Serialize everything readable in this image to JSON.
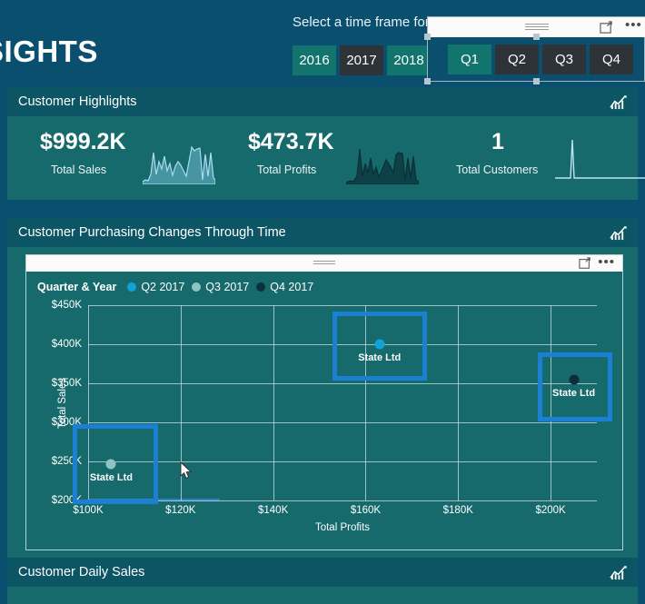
{
  "banner": {
    "title": "SIGHTS",
    "slicer_caption": "Select a time frame for analysis",
    "years": [
      {
        "label": "2016",
        "selected": true
      },
      {
        "label": "2017",
        "selected": false
      },
      {
        "label": "2018",
        "selected": true
      }
    ]
  },
  "quarter_slicer": {
    "quarters": [
      {
        "label": "Q1",
        "selected": true
      },
      {
        "label": "Q2",
        "selected": false
      },
      {
        "label": "Q3",
        "selected": false
      },
      {
        "label": "Q4",
        "selected": false
      }
    ],
    "icons": {
      "grip": "drag-grip-icon",
      "focus": "focus-mode-icon",
      "more": "•••"
    }
  },
  "cards": {
    "highlights": {
      "title": "Customer Highlights",
      "icon": "line-chart-icon",
      "kpis": [
        {
          "value": "$999.2K",
          "label": "Total Sales",
          "spark": "sales-sparkline",
          "color": "#8fd3ea"
        },
        {
          "value": "$473.7K",
          "label": "Total Profits",
          "spark": "profits-sparkline",
          "color": "#0d3b3f"
        },
        {
          "value": "1",
          "label": "Total Customers",
          "spark": "customers-sparkline",
          "color": "#bfe4ea"
        }
      ]
    },
    "scatter": {
      "title": "Customer Purchasing Changes Through Time",
      "icon": "line-chart-icon",
      "toolbar": {
        "focus": "focus-mode-icon",
        "more": "•••"
      }
    },
    "daily": {
      "title": "Customer Daily Sales",
      "icon": "line-chart-icon"
    }
  },
  "chart_data": {
    "type": "scatter",
    "title": "Customer Purchasing Changes Through Time",
    "xlabel": "Total Profits",
    "ylabel": "Total Sales",
    "legend_title": "Quarter & Year",
    "legend_position": "top-left",
    "grid": true,
    "xlim": [
      100000,
      210000
    ],
    "ylim": [
      200000,
      450000
    ],
    "xticks": [
      "$100K",
      "$120K",
      "$140K",
      "$160K",
      "$180K",
      "$200K"
    ],
    "xtick_values": [
      100000,
      120000,
      140000,
      160000,
      180000,
      200000
    ],
    "yticks": [
      "$200K",
      "$250K",
      "$300K",
      "$350K",
      "$400K",
      "$450K"
    ],
    "ytick_values": [
      200000,
      250000,
      300000,
      350000,
      400000,
      450000
    ],
    "series": [
      {
        "name": "Q2 2017",
        "color": "#12a3d6",
        "points": [
          {
            "label": "State Ltd",
            "x": 163000,
            "y": 400000,
            "highlighted": true
          }
        ]
      },
      {
        "name": "Q3 2017",
        "color": "#8fc4c4",
        "points": [
          {
            "label": "State Ltd",
            "x": 105000,
            "y": 247000,
            "highlighted": true
          }
        ]
      },
      {
        "name": "Q4 2017",
        "color": "#0d3038",
        "points": [
          {
            "label": "State Ltd",
            "x": 205000,
            "y": 355000,
            "highlighted": true
          }
        ]
      }
    ],
    "highlight_color": "#1b7fd4"
  }
}
